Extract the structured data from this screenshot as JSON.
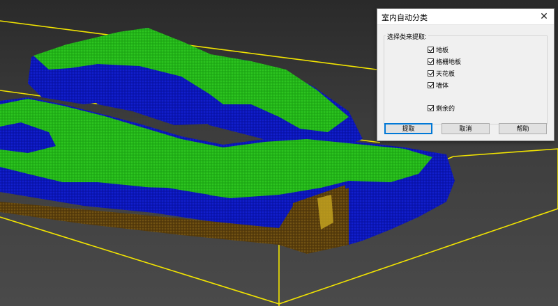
{
  "dialog": {
    "title": "室内自动分类",
    "close_symbol": "✕",
    "group_label": "选择类来提取:",
    "checkboxes": [
      {
        "label": "地板",
        "checked": true
      },
      {
        "label": "格栅地板",
        "checked": true
      },
      {
        "label": "天花板",
        "checked": true
      },
      {
        "label": "墙体",
        "checked": true
      },
      {
        "label": "剩余的",
        "checked": true
      }
    ],
    "buttons": {
      "extract": "提取",
      "cancel": "取消",
      "help": "帮助"
    }
  },
  "colors": {
    "background": "#3a3a3a",
    "bounding_box": "#f0e000",
    "wall_points": "#0a14c8",
    "floor_points": "#20c010",
    "ground_points": "#6b4a10",
    "accent": "#0078d7"
  }
}
